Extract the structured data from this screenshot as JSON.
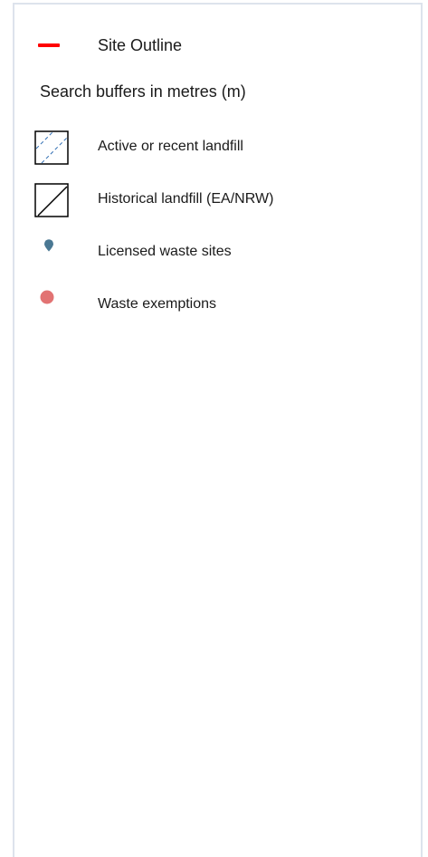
{
  "legend": {
    "site_outline": {
      "label": "Site Outline",
      "color": "#ff0000"
    },
    "buffers_label": "Search buffers in metres (m)",
    "items": [
      {
        "label": "Active or recent landfill",
        "icon": "hatched-square-icon",
        "hatch_color": "#2f6db3"
      },
      {
        "label": "Historical landfill (EA/NRW)",
        "icon": "diagonal-square-icon",
        "line_color": "#000000"
      },
      {
        "label": "Licensed waste sites",
        "icon": "map-pin-icon",
        "color": "#4a7893"
      },
      {
        "label": "Waste exemptions",
        "icon": "dot-icon",
        "color": "#e27373"
      }
    ]
  }
}
